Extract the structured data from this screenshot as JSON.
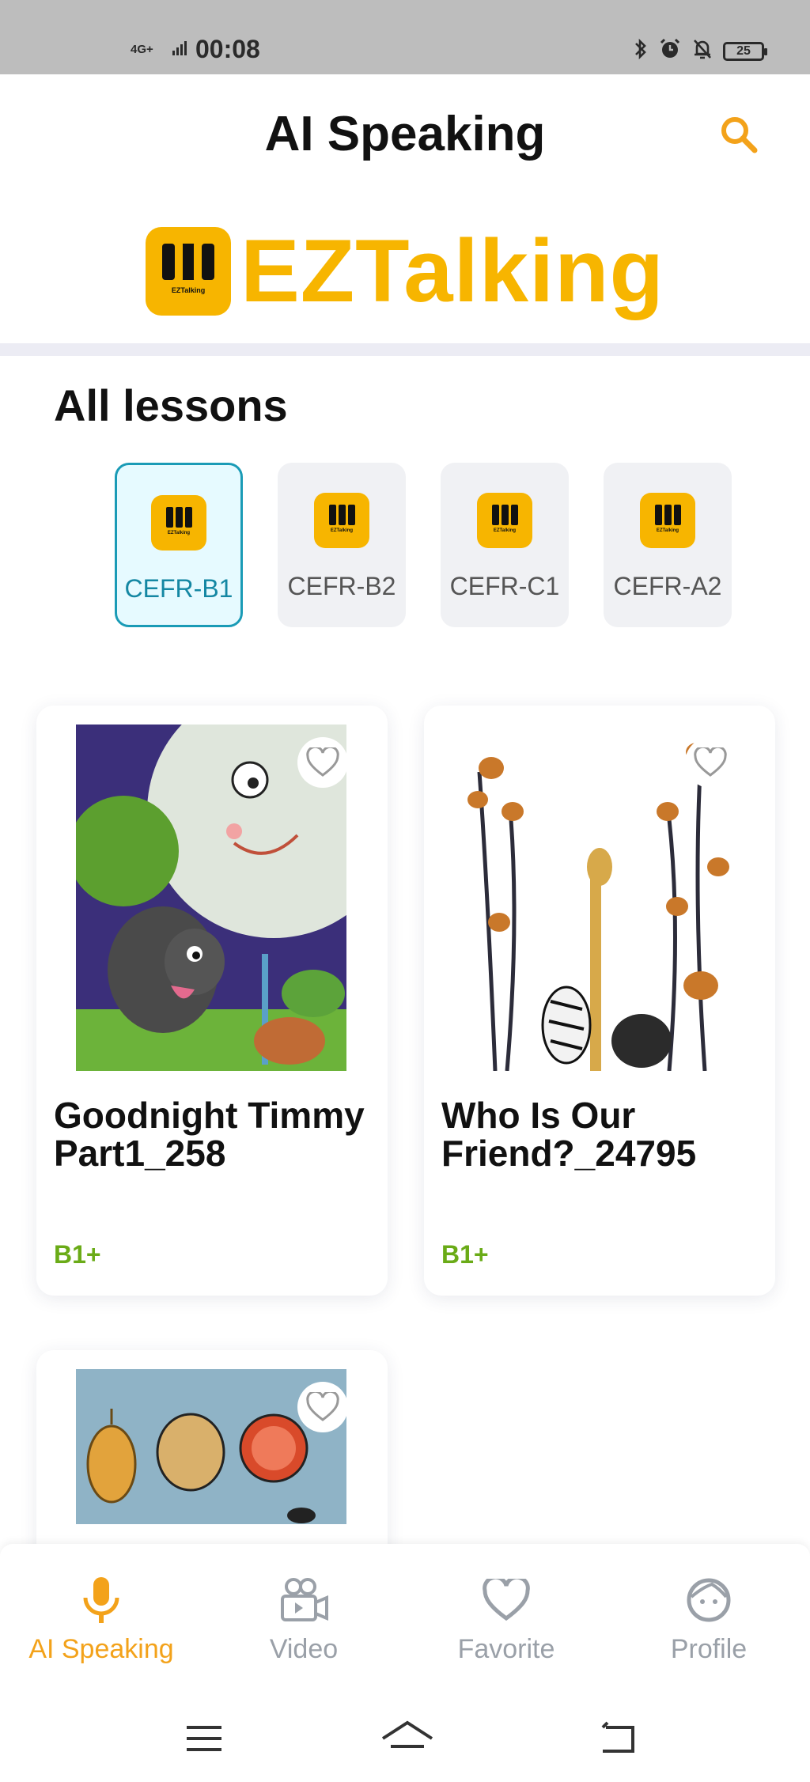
{
  "status_bar": {
    "network": "4G+",
    "time": "00:08",
    "battery": "25"
  },
  "header": {
    "title": "AI Speaking",
    "search_icon": "search-icon"
  },
  "logo": {
    "text": "EZTalking",
    "mini_text": "EZTalking"
  },
  "section": {
    "title": "All lessons"
  },
  "levels": [
    {
      "label": "CEFR-B1",
      "active": true
    },
    {
      "label": "CEFR-B2",
      "active": false
    },
    {
      "label": "CEFR-C1",
      "active": false
    },
    {
      "label": "CEFR-A2",
      "active": false
    }
  ],
  "lessons": [
    {
      "title": "Goodnight Timmy Part1_258",
      "level": "B1+",
      "image": "night-moon-dog-illustration"
    },
    {
      "title": "Who Is Our Friend?_24795",
      "level": "B1+",
      "image": "giraffe-zebra-trees-illustration"
    },
    {
      "title": "",
      "level": "",
      "image": "vegetables-illustration"
    }
  ],
  "bottom_nav": [
    {
      "label": "AI Speaking",
      "icon": "microphone-icon",
      "active": true
    },
    {
      "label": "Video",
      "icon": "video-camera-icon",
      "active": false
    },
    {
      "label": "Favorite",
      "icon": "heart-icon",
      "active": false
    },
    {
      "label": "Profile",
      "icon": "face-icon",
      "active": false
    }
  ],
  "colors": {
    "accent": "#f7b500",
    "active_level_border": "#1a9bb6",
    "level_badge": "#6aab17",
    "active_tab": "#f3a21a"
  }
}
